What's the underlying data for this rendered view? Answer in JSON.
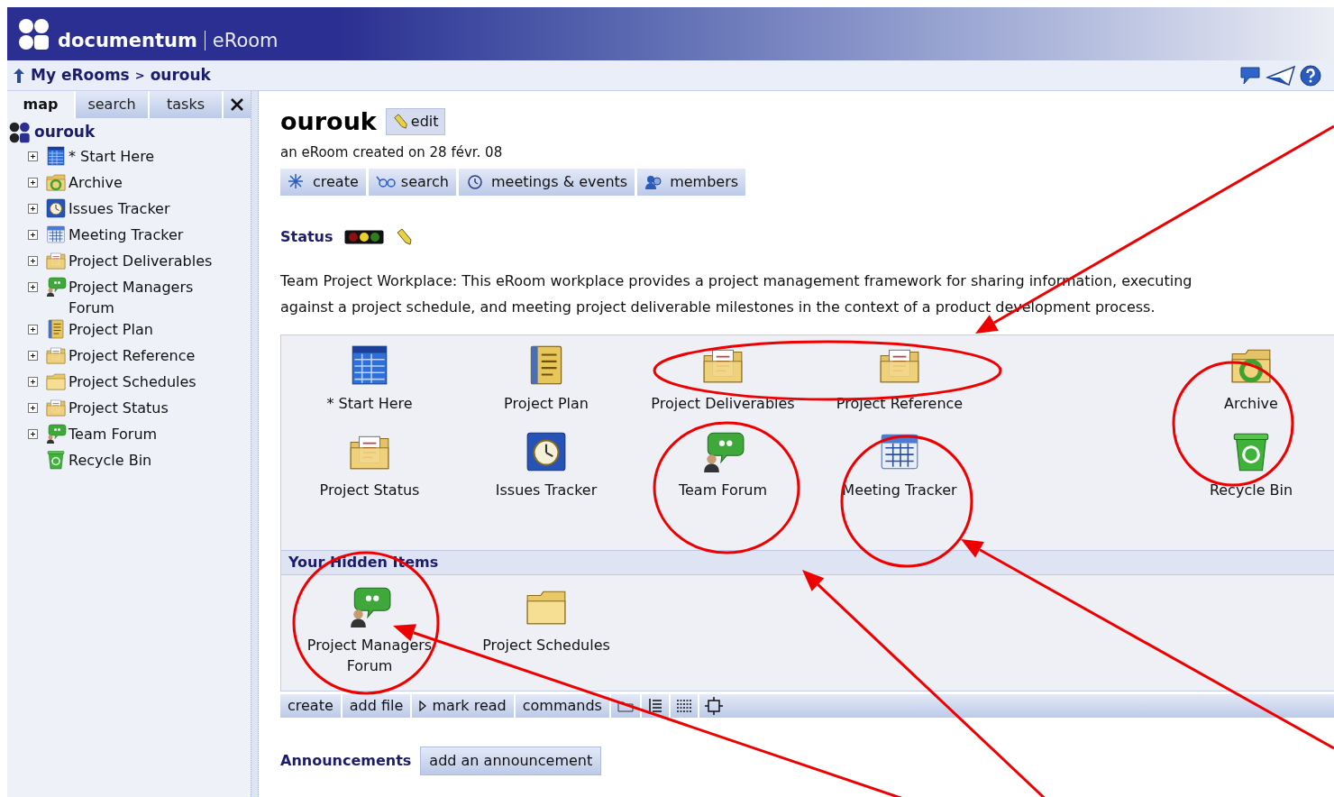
{
  "brand": {
    "name": "documentum",
    "product": "eRoom"
  },
  "breadcrumb": [
    {
      "label": "My eRooms"
    },
    {
      "label": "ourouk"
    }
  ],
  "breadcrumb_separator": ">",
  "sidebar": {
    "tabs": [
      {
        "label": "map",
        "selected": true
      },
      {
        "label": "search",
        "selected": false
      },
      {
        "label": "tasks",
        "selected": false
      }
    ],
    "root": "ourouk",
    "items": [
      {
        "label": "* Start Here",
        "kind": "grid",
        "expander": true
      },
      {
        "label": "Archive",
        "kind": "archive",
        "expander": true
      },
      {
        "label": "Issues Tracker",
        "kind": "clock",
        "expander": true
      },
      {
        "label": "Meeting Tracker",
        "kind": "calendar",
        "expander": true
      },
      {
        "label": "Project Deliverables",
        "kind": "folder-doc",
        "expander": true
      },
      {
        "label": "Project Managers Forum",
        "kind": "forum",
        "expander": true
      },
      {
        "label": "Project Plan",
        "kind": "plan",
        "expander": true
      },
      {
        "label": "Project Reference",
        "kind": "folder-doc",
        "expander": true
      },
      {
        "label": "Project Schedules",
        "kind": "folder",
        "expander": true
      },
      {
        "label": "Project Status",
        "kind": "folder-doc",
        "expander": true
      },
      {
        "label": "Team Forum",
        "kind": "forum",
        "expander": true
      },
      {
        "label": "Recycle Bin",
        "kind": "recycle",
        "expander": false
      }
    ]
  },
  "room": {
    "title": "ourouk",
    "edit_label": "edit",
    "subtitle": "an eRoom created on 28 févr. 08",
    "toolbar": [
      {
        "label": "create",
        "kind": "create"
      },
      {
        "label": "search",
        "kind": "search"
      },
      {
        "label": "meetings & events",
        "kind": "meetings"
      },
      {
        "label": "members",
        "kind": "members"
      }
    ],
    "status_label": "Status",
    "description": "Team Project Workplace: This eRoom workplace provides a project management framework for sharing information, executing against a project schedule, and meeting project deliverable milestones in the context of a product development process.",
    "items": [
      {
        "label": "* Start Here",
        "kind": "grid"
      },
      {
        "label": "Project Plan",
        "kind": "plan"
      },
      {
        "label": "Project Deliverables",
        "kind": "folder-doc"
      },
      {
        "label": "Project Reference",
        "kind": "folder-doc"
      },
      {
        "label": "Project Status",
        "kind": "folder-doc"
      },
      {
        "label": "Issues Tracker",
        "kind": "clock"
      },
      {
        "label": "Team Forum",
        "kind": "forum"
      },
      {
        "label": "Meeting Tracker",
        "kind": "calendar"
      }
    ],
    "side_items": [
      {
        "label": "Archive",
        "kind": "archive"
      },
      {
        "label": "Recycle Bin",
        "kind": "recycle"
      }
    ],
    "hidden_title": "Your Hidden Items",
    "hidden_items": [
      {
        "label": "Project Managers Forum",
        "kind": "forum"
      },
      {
        "label": "Project Schedules",
        "kind": "folder"
      }
    ],
    "bottom_toolbar": [
      {
        "label": "create"
      },
      {
        "label": "add file"
      },
      {
        "label": "mark read",
        "kind": "mark"
      },
      {
        "label": "commands"
      }
    ],
    "announcements_label": "Announcements",
    "announcement_button": "add an announcement"
  }
}
